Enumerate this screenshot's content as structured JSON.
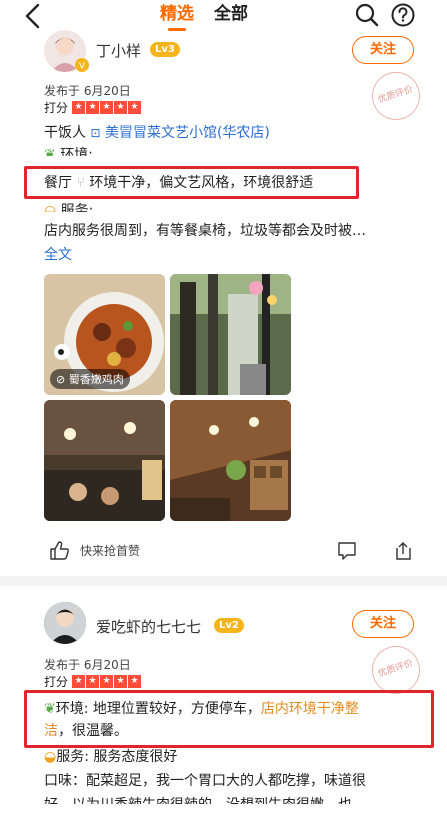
{
  "header": {
    "tab_featured": "精选",
    "tab_all": "全部",
    "icons": [
      "back-arrow-icon",
      "search-icon",
      "help-icon"
    ],
    "accent": "#ff6a00"
  },
  "review1": {
    "username": "丁小样",
    "level": "Lv3",
    "follow_label": "关注",
    "stamp": "优质评价",
    "date": "发布于 6月20日",
    "rate_label": "打分",
    "rating": 5,
    "author_tag": "干饭人",
    "shop_name": "美冒冒菜文艺小馆(华农店)",
    "env_heading": "环境:",
    "env_text": "餐厅",
    "env_text2": "环境干净，偏文艺风格，环境很舒适",
    "service_heading": "服务:",
    "service_text": "店内服务很周到，有等餐桌椅，垃圾等都会及时被…",
    "expand": "全文",
    "photo_tag": "蜀香嫩鸡肉",
    "like_label": "快来抢首赞"
  },
  "review2": {
    "username": "爱吃虾的七七七",
    "level": "Lv2",
    "follow_label": "关注",
    "stamp": "优质评价",
    "date": "发布于 6月20日",
    "rate_label": "打分",
    "rating": 5,
    "env_prefix": "环境: 地理位置较好，方便停车，",
    "env_highlight": "店内环境干净整",
    "env_highlight2": "洁",
    "env_suffix": "，很温馨。",
    "service": "服务: 服务态度很好",
    "taste": "口味：配菜超足，我一个胃口大的人都吃撑，味道很",
    "taste_cut": "好，以为川香辣牛肉很辣的，没想到牛肉很嫩，也"
  },
  "colors": {
    "accent": "#ff6a00",
    "link": "#2a6fd6",
    "star": "#ff4d3a",
    "highlight_box": "#e0252d",
    "level_badge": "#f6b41a"
  }
}
